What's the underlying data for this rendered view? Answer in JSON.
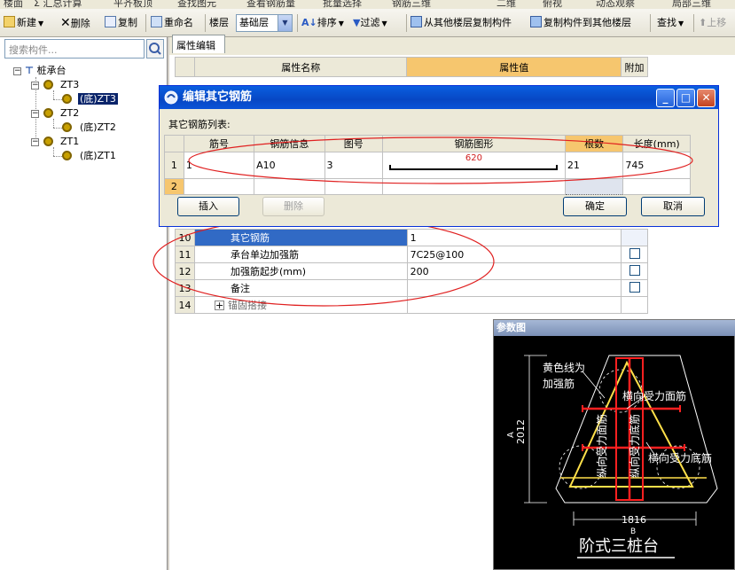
{
  "top_menu": [
    "楼面",
    "Σ 汇总计算",
    "平齐板顶",
    "查找图元",
    "查看钢筋量",
    "批量选择",
    "钢筋三维",
    "二维",
    "俯视",
    "动态观察",
    "局部三维"
  ],
  "toolbar": {
    "new": "新建",
    "delete": "删除",
    "copy": "复制",
    "rename": "重命名",
    "floor_label": "楼层",
    "floor_value": "基础层",
    "sort": "排序",
    "filter": "过滤",
    "copy_from": "从其他楼层复制构件",
    "copy_to": "复制构件到其他楼层",
    "find": "查找",
    "up": "上移"
  },
  "search": {
    "placeholder": "搜索构件..."
  },
  "tree": {
    "root": "桩承台",
    "nodes": [
      {
        "label": "ZT3",
        "child": "(底)ZT3",
        "selected": true
      },
      {
        "label": "ZT2",
        "child": "(底)ZT2",
        "selected": false
      },
      {
        "label": "ZT1",
        "child": "(底)ZT1",
        "selected": false
      }
    ]
  },
  "tab": "属性编辑",
  "props": {
    "headers": {
      "name": "属性名称",
      "value": "属性值",
      "extra": "附加"
    },
    "rows": [
      {
        "num": "10",
        "name": "其它钢筋",
        "value": "1",
        "selected": true,
        "check": false
      },
      {
        "num": "11",
        "name": "承台单边加强筋",
        "value": "7C25@100",
        "selected": false,
        "check": true
      },
      {
        "num": "12",
        "name": "加强筋起步(mm)",
        "value": "200",
        "selected": false,
        "check": true
      },
      {
        "num": "13",
        "name": "备注",
        "value": "",
        "selected": false,
        "check": true
      },
      {
        "num": "14",
        "name": "锚固搭接",
        "value": "",
        "selected": false,
        "check": false,
        "expand": "+"
      }
    ]
  },
  "dialog": {
    "title": "编辑其它钢筋",
    "list_label": "其它钢筋列表:",
    "columns": [
      "筋号",
      "钢筋信息",
      "图号",
      "钢筋图形",
      "根数",
      "长度(mm)"
    ],
    "rows": [
      {
        "num": "1",
        "code": "1",
        "info": "A10",
        "fig": "3",
        "shape_value": "620",
        "count": "21",
        "length": "745"
      },
      {
        "num": "2",
        "code": "",
        "info": "",
        "fig": "",
        "shape_value": "",
        "count": "",
        "length": ""
      }
    ],
    "buttons": {
      "insert": "插入",
      "delete": "删除",
      "ok": "确定",
      "cancel": "取消"
    }
  },
  "ref": {
    "title": "参数图",
    "labels": {
      "note1": "黄色线为",
      "note2": "加强筋",
      "top_bar": "横向受力面筋",
      "bottom_bar": "横向受力底筋",
      "long_face": "纵向受力面筋",
      "long_bottom": "纵向受力底筋",
      "dim_a_name": "A",
      "dim_a": "2012",
      "dim_b": "1816",
      "dim_b_name": "B",
      "caption": "阶式三桩台"
    }
  },
  "colors": {
    "accent": "#f6c66e",
    "selection": "#316ac5",
    "dialog_title": "#0a53d8",
    "annotation": "#e02020"
  }
}
